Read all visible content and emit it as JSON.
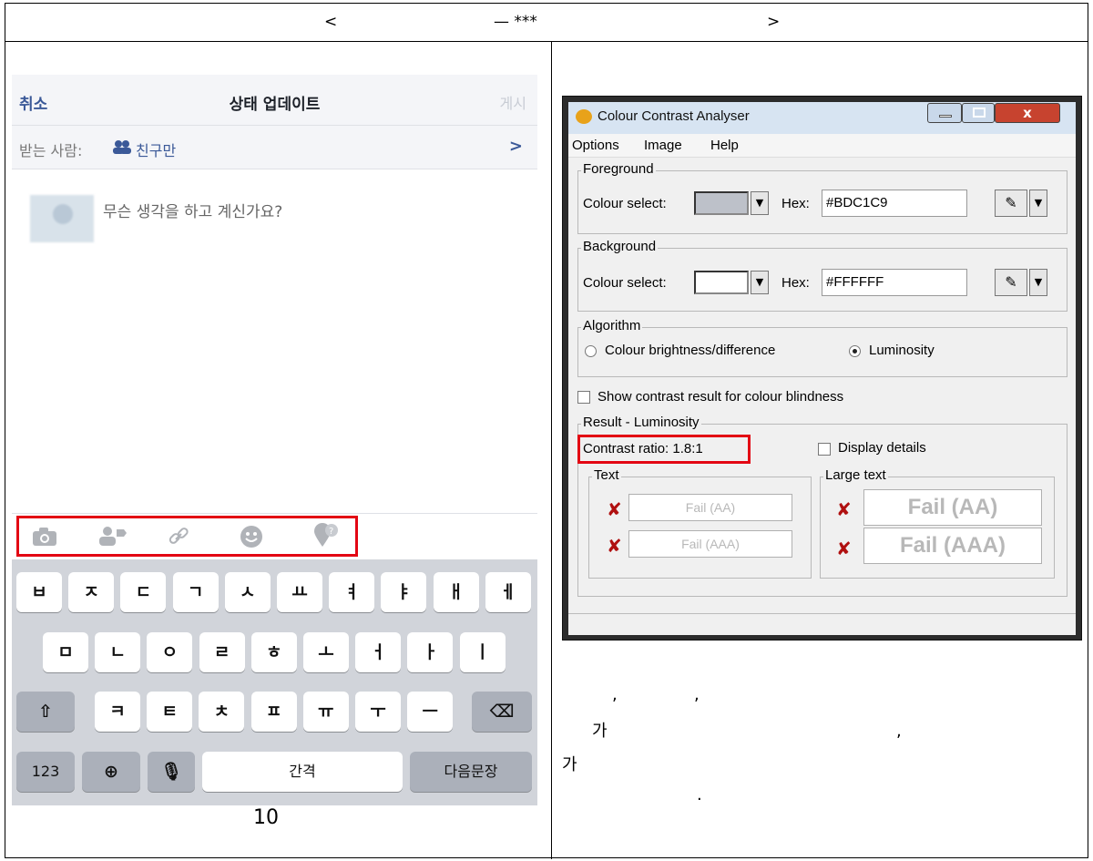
{
  "header": {
    "left": "<",
    "mid": "— ***",
    "right": ">"
  },
  "phone": {
    "cancel": "취소",
    "title": "상태 업데이트",
    "post": "게시",
    "to_label": "받는 사람:",
    "audience": "친구만",
    "chevron": ">",
    "prompt": "무슨 생각을 하고 계신가요?",
    "kbd_row1": [
      "ㅂ",
      "ㅈ",
      "ㄷ",
      "ㄱ",
      "ㅅ",
      "ㅛ",
      "ㅕ",
      "ㅑ",
      "ㅐ",
      "ㅔ"
    ],
    "kbd_row2": [
      "ㅁ",
      "ㄴ",
      "ㅇ",
      "ㄹ",
      "ㅎ",
      "ㅗ",
      "ㅓ",
      "ㅏ",
      "ㅣ"
    ],
    "kbd_row3": [
      "ㅋ",
      "ㅌ",
      "ㅊ",
      "ㅍ",
      "ㅠ",
      "ㅜ",
      "ㅡ"
    ],
    "shift": "⇧",
    "backspace": "⌫",
    "num": "123",
    "globe": "⊕",
    "mic": "🎙",
    "space": "간격",
    "next": "다음문장"
  },
  "caption": "10",
  "dialog": {
    "title": "Colour Contrast Analyser",
    "menu": [
      "Options",
      "Image",
      "Help"
    ],
    "fg_label": "Foreground",
    "fg_select": "Colour select:",
    "fg_hex_label": "Hex:",
    "fg_hex": "#BDC1C9",
    "fg_color": "#BDC1C9",
    "bg_label": "Background",
    "bg_select": "Colour select:",
    "bg_hex_label": "Hex:",
    "bg_hex": "#FFFFFF",
    "bg_color": "#FFFFFF",
    "algo_label": "Algorithm",
    "algo_opt1": "Colour brightness/difference",
    "algo_opt2": "Luminosity",
    "blind_check": "Show contrast result for colour blindness",
    "result_label": "Result - Luminosity",
    "contrast": "Contrast ratio: 1.8:1",
    "details": "Display details",
    "text_label": "Text",
    "large_label": "Large text",
    "text_aa": "Fail (AA)",
    "text_aaa": "Fail (AAA)",
    "large_aa": "Fail (AA)",
    "large_aaa": "Fail (AAA)"
  },
  "right_text": {
    "l1a": ",",
    "l1b": ",",
    "l2a": "가",
    "l2b": ",",
    "l3": "가",
    "l4": "."
  }
}
